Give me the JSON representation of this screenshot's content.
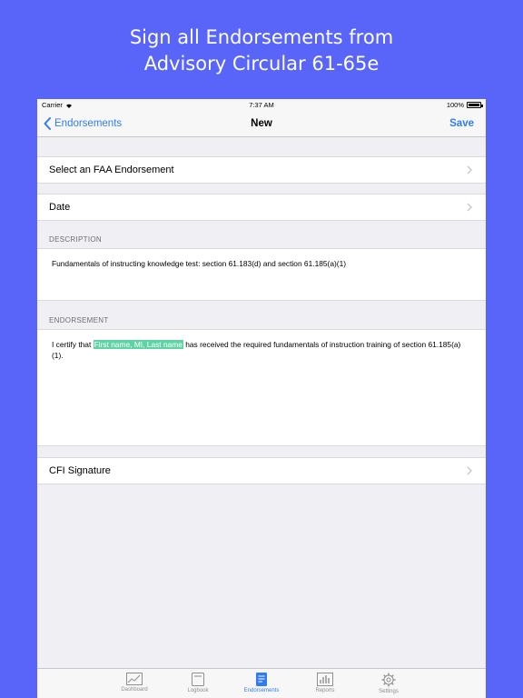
{
  "promo": {
    "line1": "Sign all Endorsements from",
    "line2": "Advisory Circular 61-65e"
  },
  "statusbar": {
    "carrier": "Carrier",
    "time": "7:37 AM",
    "battery": "100%"
  },
  "navbar": {
    "back_label": "Endorsements",
    "title": "New",
    "save_label": "Save"
  },
  "form": {
    "select_endorsement": "Select an FAA Endorsement",
    "date": "Date",
    "description_header": "DESCRIPTION",
    "description_text": "Fundamentals of instructing knowledge test: section 61.183(d) and section 61.185(a)(1)",
    "endorsement_header": "ENDORSEMENT",
    "endorsement_prefix": "I certify that ",
    "endorsement_name": "First name, MI, Last name",
    "endorsement_suffix": " has received the required fundamentals of instruction training of section 61.185(a)(1).",
    "cfi_signature": "CFI Signature"
  },
  "tabs": [
    {
      "label": "Dashboard",
      "icon": "chart-icon"
    },
    {
      "label": "Logbook",
      "icon": "logbook-icon"
    },
    {
      "label": "Endorsements",
      "icon": "endorsement-icon",
      "active": true
    },
    {
      "label": "Reports",
      "icon": "reports-icon"
    },
    {
      "label": "Settings",
      "icon": "gear-icon"
    }
  ],
  "colors": {
    "background": "#5865f8",
    "accent": "#2f7cf6",
    "highlight": "#5fd3a5",
    "table_bg": "#efeff4"
  }
}
